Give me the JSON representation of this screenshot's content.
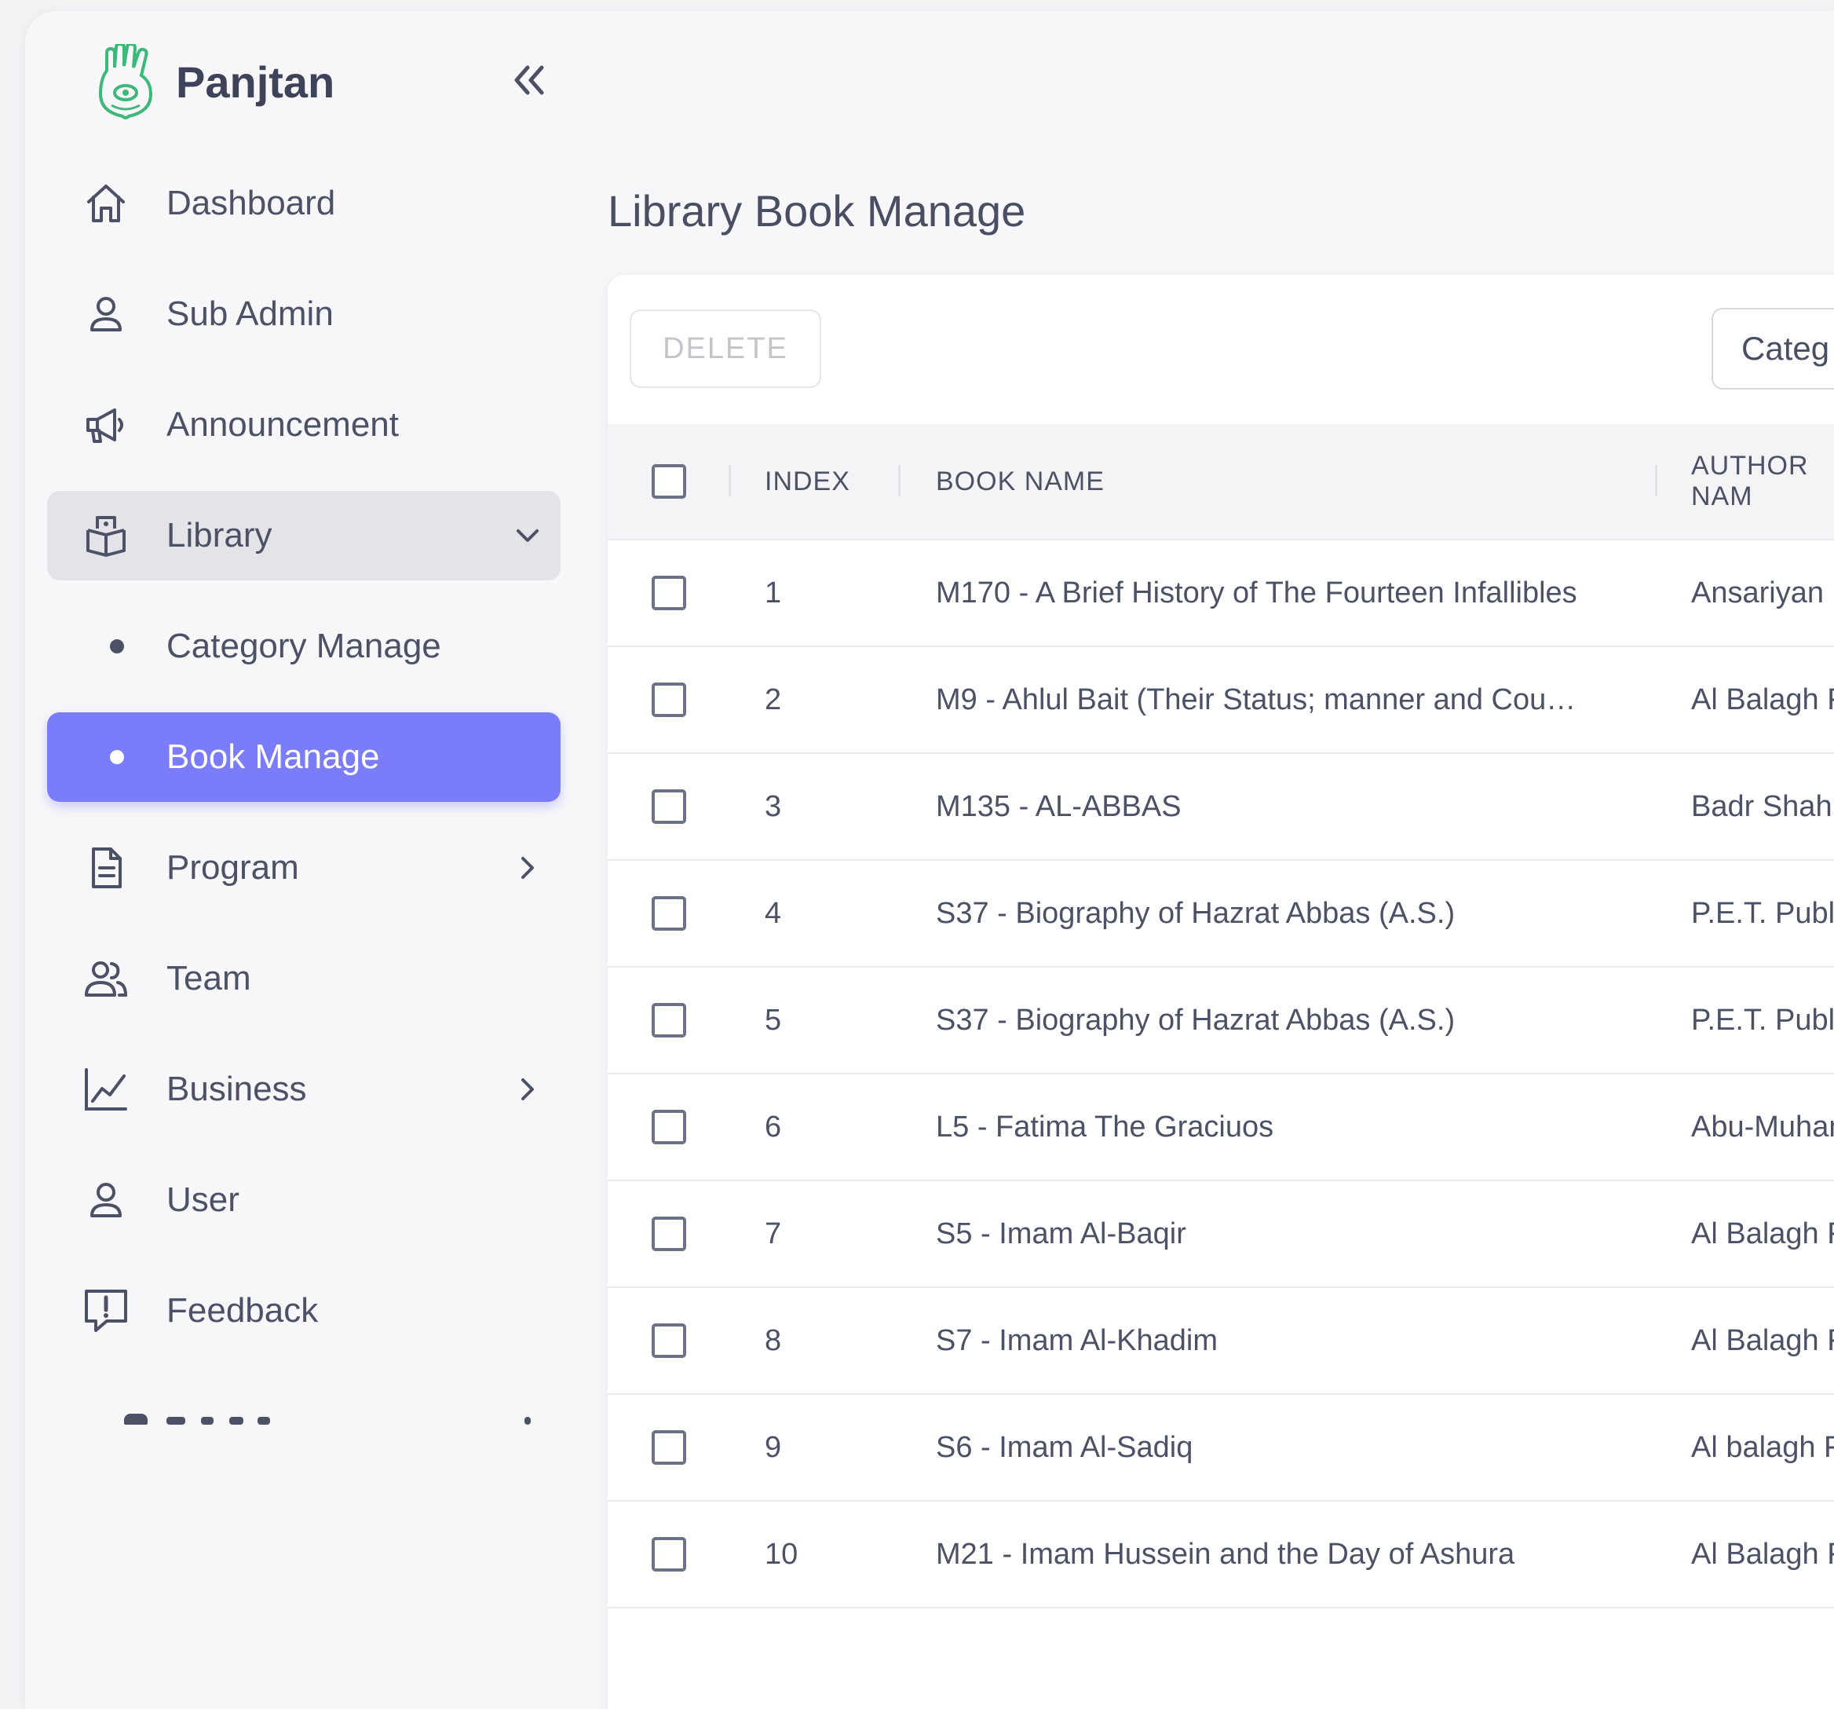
{
  "brand": {
    "name": "Panjtan"
  },
  "sidebar": {
    "items": [
      {
        "label": "Dashboard",
        "icon": "home-icon"
      },
      {
        "label": "Sub Admin",
        "icon": "user-icon"
      },
      {
        "label": "Announcement",
        "icon": "megaphone-icon"
      },
      {
        "label": "Library",
        "icon": "library-icon",
        "expanded": true
      },
      {
        "label": "Category Manage"
      },
      {
        "label": "Book Manage",
        "active": true
      },
      {
        "label": "Program",
        "icon": "document-icon"
      },
      {
        "label": "Team",
        "icon": "team-icon"
      },
      {
        "label": "Business",
        "icon": "chart-icon"
      },
      {
        "label": "User",
        "icon": "user-icon"
      },
      {
        "label": "Feedback",
        "icon": "feedback-icon"
      }
    ]
  },
  "page": {
    "title": "Library Book Manage"
  },
  "toolbar": {
    "delete_label": "DELETE",
    "category_label": "Categ"
  },
  "table": {
    "headers": {
      "index": "INDEX",
      "book_name": "BOOK NAME",
      "author": "AUTHOR NAM"
    },
    "rows": [
      {
        "index": "1",
        "book": "M170 - A Brief History of The Fourteen Infallibles",
        "author": "Ansariyan P"
      },
      {
        "index": "2",
        "book": "M9 - Ahlul Bait (Their Status; manner and Cou…",
        "author": "Al Balagh Fo"
      },
      {
        "index": "3",
        "book": "M135 - AL-ABBAS",
        "author": "Badr Shahin"
      },
      {
        "index": "4",
        "book": "S37 - Biography of Hazrat Abbas (A.S.)",
        "author": "P.E.T. Public"
      },
      {
        "index": "5",
        "book": "S37 - Biography of Hazrat Abbas (A.S.)",
        "author": "P.E.T. Public"
      },
      {
        "index": "6",
        "book": "L5 - Fatima The Graciuos",
        "author": "Abu-Muham"
      },
      {
        "index": "7",
        "book": "S5 - Imam Al-Baqir",
        "author": "Al Balagh Fo"
      },
      {
        "index": "8",
        "book": "S7 - Imam Al-Khadim",
        "author": "Al Balagh Fo"
      },
      {
        "index": "9",
        "book": "S6 - Imam Al-Sadiq",
        "author": "Al balagh Fo"
      },
      {
        "index": "10",
        "book": "M21 - Imam Hussein and the Day of Ashura",
        "author": "Al Balagh Fo"
      }
    ]
  },
  "colors": {
    "accent": "#7a7cf9",
    "brand_green": "#3cb878"
  }
}
